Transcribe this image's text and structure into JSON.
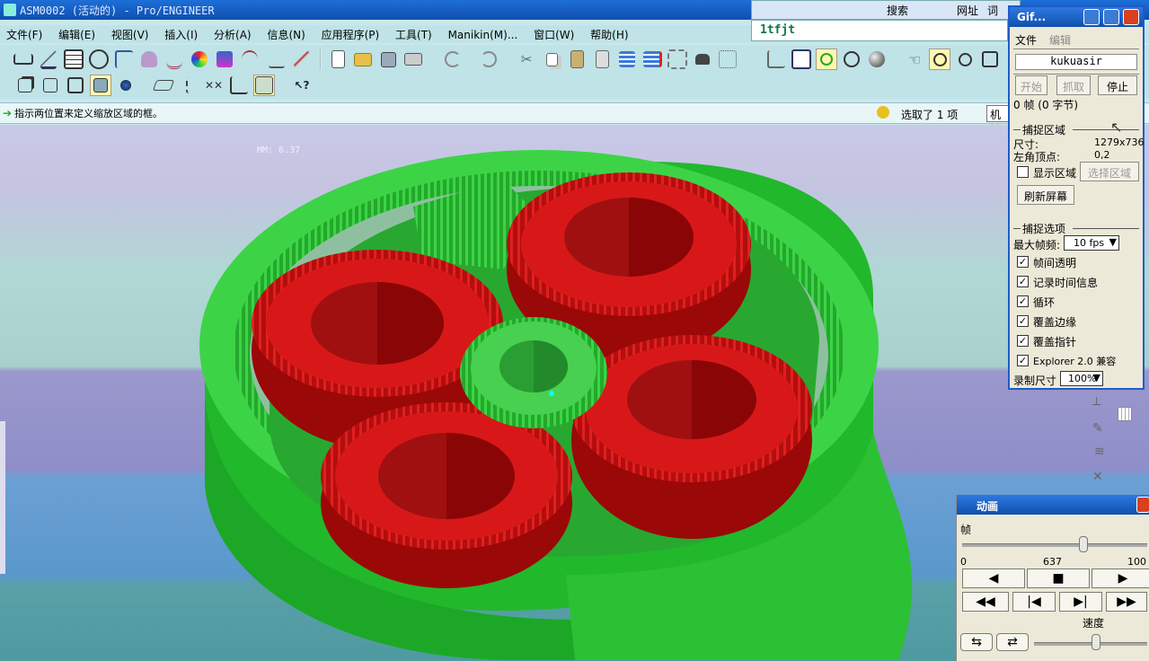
{
  "window": {
    "title": "ASM0002 (活动的) - Pro/ENGINEER"
  },
  "menu": {
    "items": [
      "文件(F)",
      "编辑(E)",
      "视图(V)",
      "插入(I)",
      "分析(A)",
      "信息(N)",
      "应用程序(P)",
      "工具(T)",
      "Manikin(M)...",
      "窗口(W)",
      "帮助(H)"
    ]
  },
  "status": {
    "message": "指示两位置来定义缩放区域的框。",
    "selected": "选取了 1 项",
    "filter": "机械"
  },
  "viewport": {
    "scale_label": "MM: 6.37",
    "colors": {
      "ring": "#2ecc3a",
      "planet": "#dd1414",
      "sun": "#4ad84a"
    }
  },
  "search": {
    "button": "搜索",
    "address": "网址",
    "word": "词",
    "text": "1tfjt"
  },
  "gif": {
    "title": "Gif...",
    "menu_file": "文件",
    "menu_edit": "编辑",
    "user": "kukuasir",
    "btn_start": "开始",
    "btn_capture": "抓取",
    "btn_stop": "停止",
    "frames": "0 帧 (0 字节)",
    "section_capture": "捕捉区域",
    "size_label": "尺寸:",
    "size_value": "1279x736",
    "corner_label": "左角顶点:",
    "corner_value": "0,2",
    "show_region": "显示区域",
    "select_region": "选择区域",
    "refresh": "刷新屏幕",
    "section_options": "捕捉选项",
    "max_fps_label": "最大帧频:",
    "max_fps_value": "10 fps",
    "opt_transparent": "帧间透明",
    "opt_time": "记录时间信息",
    "opt_loop": "循环",
    "opt_edge": "覆盖边缘",
    "opt_pointer": "覆盖指针",
    "opt_explorer": "Explorer 2.0 兼容",
    "record_size_label": "录制尺寸",
    "record_size_value": "100%"
  },
  "animation": {
    "title": "动画",
    "frame_label": "帧",
    "min": "0",
    "current": "637",
    "max": "100",
    "speed_label": "速度"
  }
}
